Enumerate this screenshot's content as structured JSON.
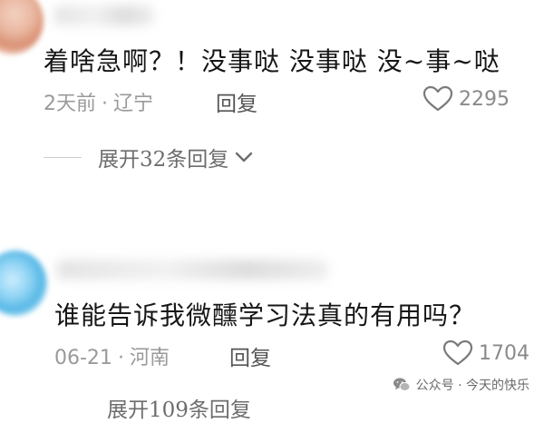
{
  "comments": [
    {
      "text": "着啥急啊？！没事哒 没事哒 没~事~哒",
      "time": "2天前",
      "location": "辽宁",
      "reply_label": "回复",
      "likes": "2295",
      "expand_label": "展开32条回复"
    },
    {
      "text": "谁能告诉我微醺学习法真的有用吗？",
      "time": "06-21",
      "location": "河南",
      "reply_label": "回复",
      "likes": "1704",
      "expand_label": "展开109条回复"
    }
  ],
  "separator": "·",
  "watermark": {
    "text": "公众号 · 今天的快乐",
    "icon": "wechat-icon"
  },
  "colors": {
    "text": "#161616",
    "meta": "#9a9a9a",
    "reply": "#555555",
    "watermark_bg": "#ffffff"
  }
}
